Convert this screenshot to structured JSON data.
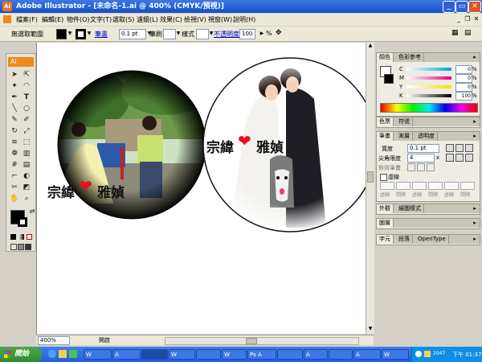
{
  "window": {
    "title": "Adobe Illustrator - [未命名-1.ai @ 400% (CMYK/預視)]",
    "app_icon": "Ai"
  },
  "menubar": {
    "items": [
      "檔案(F)",
      "編輯(E)",
      "物件(O)",
      "文字(T)",
      "選取(S)",
      "濾鏡(L)",
      "效果(C)",
      "檢視(V)",
      "視窗(W)",
      "說明(H)"
    ]
  },
  "control_bar": {
    "no_selection": "無選取範圍",
    "stroke_label": "筆畫",
    "stroke_weight": "0.1 pt",
    "brush_label": "筆刷",
    "style_label": "樣式",
    "opacity_label": "不透明度",
    "opacity_value": "100",
    "opacity_unit": "%"
  },
  "toolbox": {
    "logo": "Ai",
    "tools": [
      "selection-tool",
      "direct-selection-tool",
      "magic-wand-tool",
      "lasso-tool",
      "pen-tool",
      "type-tool",
      "line-tool",
      "ellipse-tool",
      "paintbrush-tool",
      "pencil-tool",
      "rotate-tool",
      "scale-tool",
      "warp-tool",
      "free-transform-tool",
      "symbol-tool",
      "graph-tool",
      "mesh-tool",
      "gradient-tool",
      "eyedropper-tool",
      "blend-tool",
      "scissors-tool",
      "slice-tool",
      "hand-tool",
      "zoom-tool"
    ]
  },
  "artwork": {
    "left_caption": "宗緯",
    "left_caption_right": "雅媜",
    "right_caption": "宗緯",
    "right_caption_right": "雅媜",
    "heart_color": "#e8101c"
  },
  "status": {
    "zoom": "400%",
    "state": "開啟"
  },
  "panels": {
    "color_tabs": [
      "顏色",
      "色彩參考"
    ],
    "channels": [
      {
        "label": "C",
        "value": "0",
        "unit": "%"
      },
      {
        "label": "M",
        "value": "0",
        "unit": "%"
      },
      {
        "label": "Y",
        "value": "0",
        "unit": "%"
      },
      {
        "label": "K",
        "value": "100",
        "unit": "%"
      }
    ],
    "swatch_tabs": [
      "色票",
      "符號"
    ],
    "stroke_tabs": [
      "筆畫",
      "漸層",
      "透明度"
    ],
    "stroke_weight_label": "寬度",
    "stroke_weight_value": "0.1 pt",
    "miter_label": "尖角限度",
    "miter_value": "4",
    "miter_unit": "x",
    "align_stroke_label": "對齊筆畫",
    "dashed_label": "虛線",
    "dash_labels": [
      "虛線",
      "間隔",
      "虛線",
      "間隔",
      "虛線",
      "間隔"
    ],
    "appearance_tabs": [
      "外觀",
      "繪圖樣式"
    ],
    "layers_tabs": [
      "圖層"
    ],
    "char_tabs": [
      "字元",
      "段落",
      "OpenType"
    ]
  },
  "taskbar": {
    "start_label": "開始",
    "buttons": [
      "W",
      "A",
      "",
      "W",
      "",
      "W",
      "Ps A",
      "",
      "A",
      "",
      "A",
      "W"
    ],
    "clock": "下午 01:37",
    "ime": "2047"
  },
  "colors": {
    "titlebar": "#1450c8",
    "ai_orange": "#f08a1c",
    "taskbar": "#245edb",
    "start_green": "#3a9a36"
  }
}
